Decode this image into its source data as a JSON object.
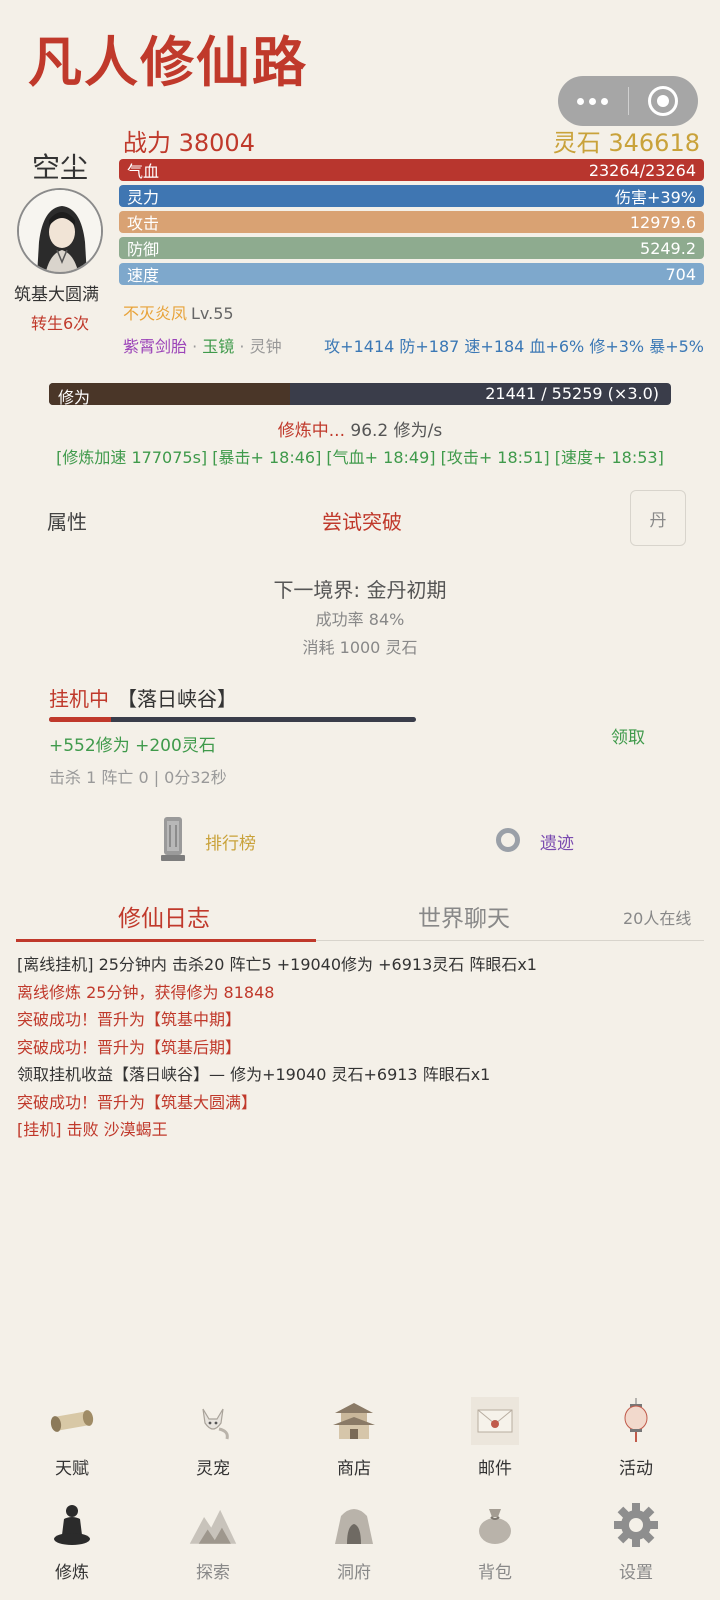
{
  "app_title": "凡人修仙路",
  "player": {
    "name": "空尘",
    "realm": "筑基大圆满",
    "rebirth": "转生6次",
    "power": "战力 38004",
    "stones": "灵石 346618"
  },
  "stats": [
    {
      "label": "气血",
      "value": "23264/23264",
      "color": "#b8362e"
    },
    {
      "label": "灵力",
      "value": "伤害+39%",
      "color": "#3f76b2"
    },
    {
      "label": "攻击",
      "value": "12979.6",
      "color": "#d9a273"
    },
    {
      "label": "防御",
      "value": "5249.2",
      "color": "#8eab8f"
    },
    {
      "label": "速度",
      "value": "704",
      "color": "#7ea8cc"
    }
  ],
  "treasure": {
    "name": "不灭炎凤",
    "level": "Lv.55"
  },
  "equipment": {
    "item1": "紫霄剑胎",
    "sep1": "·",
    "item2": "玉镜",
    "sep2": "·",
    "item3": "灵钟"
  },
  "bonus_text": "攻+1414 防+187 速+184 血+6% 修+3% 暴+5%",
  "cultivation": {
    "label": "修为",
    "value": "21441 / 55259 (×3.0)",
    "progress": 0.388,
    "status": "修炼中...",
    "rate": "96.2 修为/s",
    "buffs": "[修炼加速 177075s] [暴击+ 18:46] [气血+ 18:49] [攻击+ 18:51] [速度+ 18:53]"
  },
  "breakthrough": {
    "attr_tab": "属性",
    "button": "尝试突破",
    "pill_button": "丹",
    "next_realm": "下一境界: 金丹初期",
    "success_rate": "成功率 84%",
    "cost": "消耗 1000 灵石"
  },
  "afk": {
    "status": "挂机中",
    "location": "【落日峡谷】",
    "progress": 0.17,
    "gains": "+552修为  +200灵石",
    "claim": "领取",
    "stats": "击杀 1  阵亡 0  |  0分32秒"
  },
  "links": {
    "ranking": "排行榜",
    "ruins": "遗迹"
  },
  "tabs": {
    "log": "修仙日志",
    "chat": "世界聊天",
    "online": "20人在线"
  },
  "logs": [
    {
      "text": "[离线挂机] 25分钟内 击杀20 阵亡5 +19040修为 +6913灵石 阵眼石x1",
      "color": "dark"
    },
    {
      "text": "离线修炼 25分钟，获得修为 81848",
      "color": "red"
    },
    {
      "text": "突破成功！晋升为【筑基中期】",
      "color": "red"
    },
    {
      "text": "突破成功！晋升为【筑基后期】",
      "color": "red"
    },
    {
      "text": "领取挂机收益【落日峡谷】— 修为+19040 灵石+6913 阵眼石x1",
      "color": "dark"
    },
    {
      "text": "突破成功！晋升为【筑基大圆满】",
      "color": "red"
    },
    {
      "text": "[挂机] 击败 沙漠蝎王",
      "color": "red"
    }
  ],
  "nav_top": [
    {
      "label": "天赋",
      "icon": "scroll-icon"
    },
    {
      "label": "灵宠",
      "icon": "fox-icon"
    },
    {
      "label": "商店",
      "icon": "pavilion-icon"
    },
    {
      "label": "邮件",
      "icon": "envelope-icon"
    },
    {
      "label": "活动",
      "icon": "lantern-icon"
    }
  ],
  "nav_bottom": [
    {
      "label": "修炼",
      "icon": "meditation-icon"
    },
    {
      "label": "探索",
      "icon": "mountain-icon"
    },
    {
      "label": "洞府",
      "icon": "cave-icon"
    },
    {
      "label": "背包",
      "icon": "bag-icon"
    },
    {
      "label": "设置",
      "icon": "gear-icon"
    }
  ]
}
